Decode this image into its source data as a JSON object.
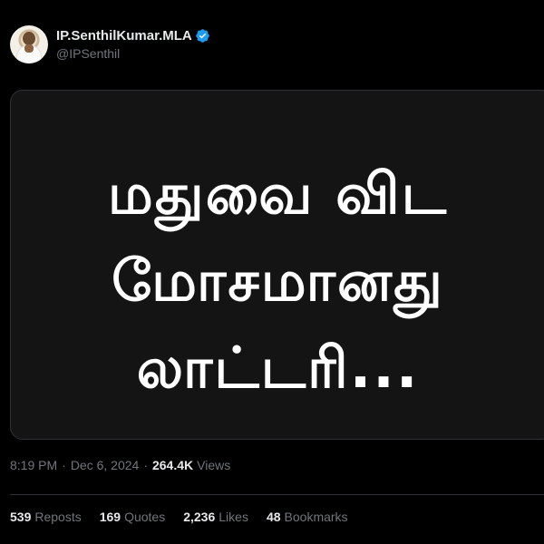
{
  "author": {
    "display_name": "IP.SenthilKumar.MLA",
    "handle": "@IPSenthil",
    "verified_icon": "verified-badge-icon",
    "verified_color": "#1d9bf0"
  },
  "media": {
    "lines": [
      "மதுவை விட",
      "மோசமானது",
      "லாட்டரி..."
    ],
    "background_color": "#141414"
  },
  "meta": {
    "time": "8:19 PM",
    "separator": "·",
    "date": "Dec 6, 2024",
    "views_count": "264.4K",
    "views_label": "Views"
  },
  "stats": [
    {
      "count": "539",
      "label": "Reposts"
    },
    {
      "count": "169",
      "label": "Quotes"
    },
    {
      "count": "2,236",
      "label": "Likes"
    },
    {
      "count": "48",
      "label": "Bookmarks"
    }
  ],
  "colors": {
    "background": "#000000",
    "text_primary": "#e7e9ea",
    "text_secondary": "#71767b",
    "border": "#2f3336"
  }
}
